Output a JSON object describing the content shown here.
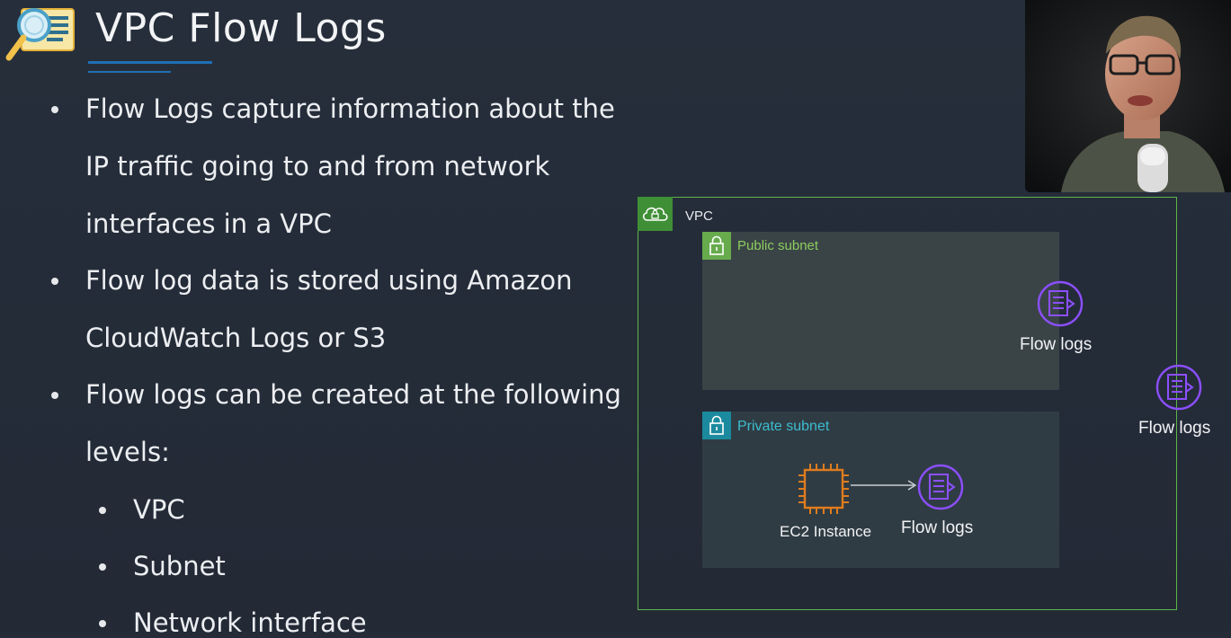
{
  "slide": {
    "title": "VPC Flow Logs",
    "bullets": [
      {
        "lines": [
          "Flow Logs capture information about the",
          "IP traffic going to and from network",
          "interfaces in a VPC"
        ]
      },
      {
        "lines": [
          "Flow log data is stored using Amazon",
          "CloudWatch Logs or S3"
        ]
      },
      {
        "lines": [
          "Flow logs can be created at the following",
          "levels:"
        ]
      }
    ],
    "sub_bullets": [
      "VPC",
      "Subnet",
      "Network interface"
    ]
  },
  "diagram": {
    "vpc_label": "VPC",
    "public_subnet_label": "Public subnet",
    "private_subnet_label": "Private subnet",
    "flow_logs_public_label": "Flow logs",
    "flow_logs_vpc_label": "Flow logs",
    "flow_logs_eni_label": "Flow logs",
    "ec2_label": "EC2 Instance",
    "colors": {
      "vpc_green": "#5fb548",
      "public_green": "#67ab4d",
      "private_teal": "#1c8a9e",
      "flow_logs_purple": "#8c4fff",
      "ec2_orange": "#e07c1d"
    }
  }
}
